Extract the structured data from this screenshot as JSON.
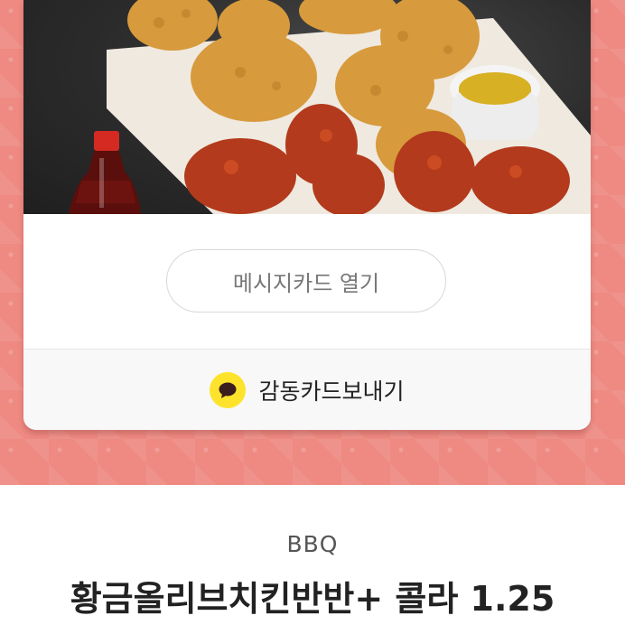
{
  "gift_card": {
    "photo_alt": "fried chicken with cola",
    "message_button_label": "메시지카드 열기",
    "send_label": "감동카드보내기",
    "send_icon": "kakaotalk-speech-bubble-icon"
  },
  "product": {
    "brand": "BBQ",
    "name": "황금올리브치킨반반+ 콜라 1.25"
  },
  "colors": {
    "background": "#ee8a82",
    "kakao_yellow": "#fde32b",
    "text_dark": "#222222",
    "text_muted": "#777777"
  }
}
